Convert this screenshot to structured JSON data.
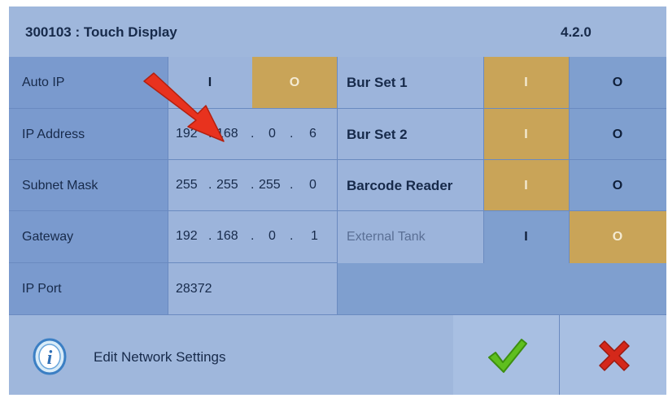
{
  "header": {
    "title": "300103 : Touch Display",
    "version": "4.2.0"
  },
  "left_rows": [
    {
      "label": "Auto IP"
    },
    {
      "label": "IP Address",
      "octets": [
        "192",
        "168",
        "0",
        "6"
      ]
    },
    {
      "label": "Subnet Mask",
      "octets": [
        "255",
        "255",
        "255",
        "0"
      ]
    },
    {
      "label": "Gateway",
      "octets": [
        "192",
        "168",
        "0",
        "1"
      ]
    },
    {
      "label": "IP Port",
      "value": "28372"
    }
  ],
  "auto_ip": {
    "on_label": "I",
    "off_label": "O",
    "selected": "O"
  },
  "ip_separator": ".",
  "right_rows": [
    {
      "label": "Bur Set 1",
      "on_label": "I",
      "off_label": "O",
      "selected": "I"
    },
    {
      "label": "Bur Set 2",
      "on_label": "I",
      "off_label": "O",
      "selected": "I"
    },
    {
      "label": "Barcode Reader",
      "on_label": "I",
      "off_label": "O",
      "selected": "I"
    },
    {
      "label": "External Tank",
      "on_label": "I",
      "off_label": "O",
      "selected": "O"
    }
  ],
  "footer": {
    "text": "Edit Network Settings"
  },
  "icons": {
    "info": "info-icon",
    "confirm": "checkmark-icon",
    "cancel": "close-icon",
    "annotation": "red-arrow-icon"
  },
  "colors": {
    "toggle_selected": "#c9a458",
    "confirm": "#5fbf1e",
    "cancel": "#d4281a",
    "arrow": "#e8321e"
  }
}
